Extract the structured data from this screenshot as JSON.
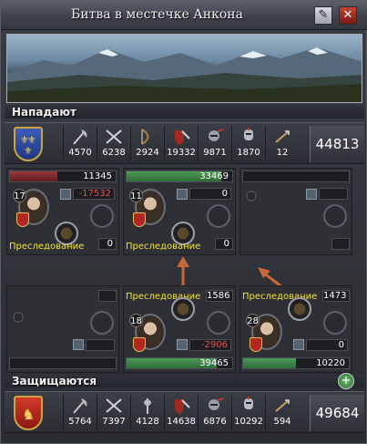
{
  "window": {
    "title": "Битва в местечке Анкона"
  },
  "attackers": {
    "label": "Нападают",
    "units": [
      {
        "icon": "axe-icon",
        "count": "4570"
      },
      {
        "icon": "crossed-swords-icon",
        "count": "6238"
      },
      {
        "icon": "bow-icon",
        "count": "2924"
      },
      {
        "icon": "shield-sword-icon",
        "count": "19332"
      },
      {
        "icon": "horse-knight-icon",
        "count": "9871"
      },
      {
        "icon": "armored-horse-icon",
        "count": "1870"
      },
      {
        "icon": "horse-archer-icon",
        "count": "12"
      }
    ],
    "total": "44813",
    "flanks": [
      {
        "bar_value": "11345",
        "level": "17",
        "morale_box": "-17532",
        "tactic_label": "Преследование",
        "tactic_count": "0",
        "fill": 0.45
      },
      {
        "bar_value": "33469",
        "level": "11",
        "morale_box": "0",
        "tactic_label": "Преследование",
        "tactic_count": "0",
        "fill": 0.9
      },
      {
        "bar_value": "",
        "level": "",
        "morale_box": "",
        "tactic_label": "",
        "tactic_count": "0",
        "fill": 0
      }
    ]
  },
  "defenders": {
    "label": "Защищаются",
    "units": [
      {
        "icon": "axe-icon",
        "count": "5764"
      },
      {
        "icon": "crossed-swords-icon",
        "count": "7397"
      },
      {
        "icon": "bow-icon",
        "count": "4128"
      },
      {
        "icon": "shield-sword-icon",
        "count": "14638"
      },
      {
        "icon": "horse-knight-icon",
        "count": "6876"
      },
      {
        "icon": "armored-horse-icon",
        "count": "10292"
      },
      {
        "icon": "horse-archer-icon",
        "count": "594"
      }
    ],
    "total": "49684",
    "flanks": [
      {
        "bar_value": "",
        "level": "",
        "morale_box": "",
        "tactic_label": "",
        "tactic_count": "",
        "fill": 0
      },
      {
        "bar_value": "39465",
        "level": "18",
        "morale_box": "-2906",
        "tactic_label": "Преследование",
        "tactic_count": "1586",
        "fill": 0.85
      },
      {
        "bar_value": "10220",
        "level": "28",
        "morale_box": "0",
        "tactic_label": "Преследование",
        "tactic_count": "1473",
        "fill": 0.5
      }
    ]
  }
}
